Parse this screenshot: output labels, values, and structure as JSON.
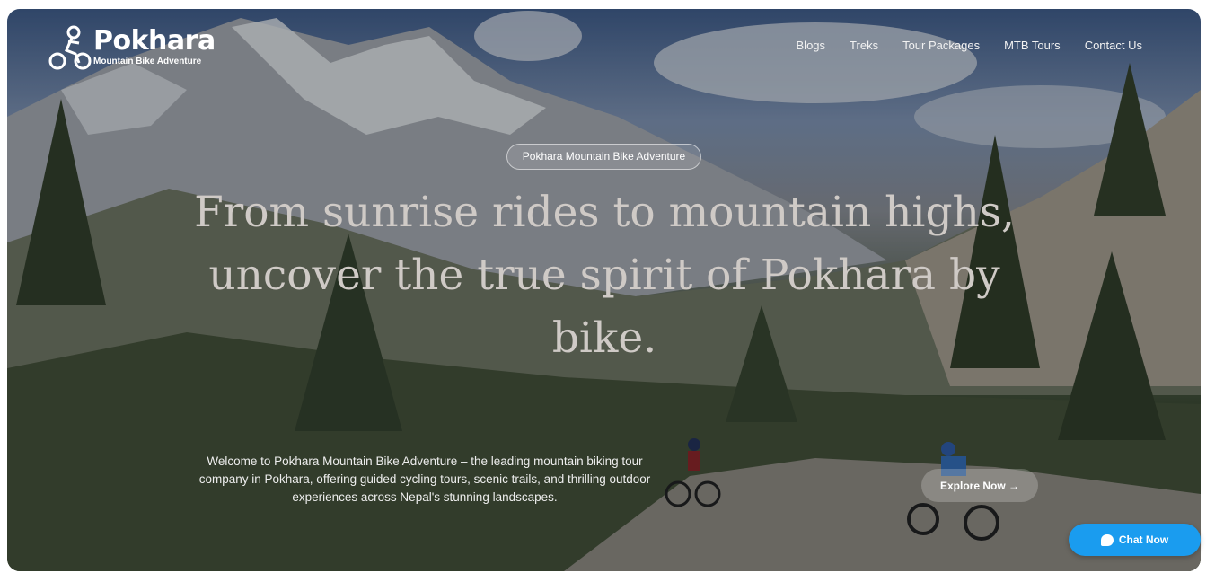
{
  "brand": {
    "name": "Pokhara",
    "tagline": "Mountain Bike Adventure"
  },
  "nav": {
    "items": [
      "Blogs",
      "Treks",
      "Tour Packages",
      "MTB Tours",
      "Contact Us"
    ]
  },
  "hero": {
    "badge": "Pokhara Mountain Bike Adventure",
    "headline_line1": "From sunrise rides to mountain highs,",
    "headline_line2": "uncover the true spirit of Pokhara by",
    "headline_line3": "bike.",
    "intro": "Welcome to Pokhara Mountain Bike Adventure – the leading mountain biking tour company in Pokhara, offering guided cycling tours, scenic trails, and thrilling outdoor experiences across Nepal's stunning landscapes.",
    "cta": "Explore Now →"
  },
  "chat": {
    "label": "Chat Now"
  },
  "colors": {
    "chat_button": "#1a9cef",
    "headline": "#cfcac6"
  }
}
